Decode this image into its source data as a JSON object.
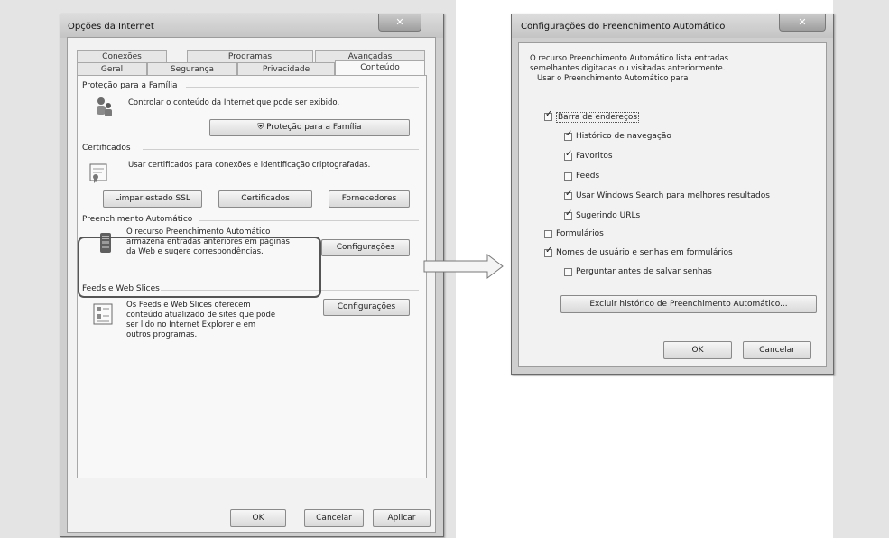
{
  "internet_options": {
    "title": "Opções da Internet",
    "close": "✕",
    "tabs_row1": [
      "Conexões",
      "Programas",
      "Avançadas"
    ],
    "tabs_row2": [
      "Geral",
      "Segurança",
      "Privacidade",
      "Conteúdo"
    ],
    "family": {
      "title": "Proteção para a Família",
      "text": "Controlar o conteúdo da Internet que pode ser exibido.",
      "button": "Proteção para a Família"
    },
    "certificates": {
      "title": "Certificados",
      "text": "Usar certificados para conexões e identificação criptografadas.",
      "buttons": [
        "Limpar estado SSL",
        "Certificados",
        "Fornecedores"
      ]
    },
    "autocomplete": {
      "title": "Preenchimento Automático",
      "text_lines": [
        "O recurso Preenchimento Automático",
        "armazena entradas anteriores em páginas",
        "da Web e sugere correspondências."
      ],
      "button": "Configurações"
    },
    "feeds": {
      "title": "Feeds e Web Slices",
      "text_lines": [
        "Os Feeds e Web Slices oferecem",
        "conteúdo atualizado de sites que pode",
        "ser lido no Internet Explorer e em",
        "outros programas."
      ],
      "button": "Configurações"
    },
    "footer": [
      "OK",
      "Cancelar",
      "Aplicar"
    ]
  },
  "autocomplete_settings": {
    "title": "Configurações do Preenchimento Automático",
    "close": "✕",
    "intro_lines": [
      "O recurso Preenchimento Automático lista entradas",
      "semelhantes digitadas ou visitadas anteriormente.",
      "Usar o Preenchimento Automático para"
    ],
    "options": {
      "address_bar": "Barra de endereços",
      "history": "Histórico de navegação",
      "favorites": "Favoritos",
      "feeds": "Feeds",
      "windows_search": "Usar Windows Search para melhores resultados",
      "suggest_urls": "Sugerindo URLs",
      "forms": "Formulários",
      "usernames": "Nomes de usuário e senhas em formulários",
      "ask_save": "Perguntar antes de salvar senhas"
    },
    "delete_history": "Excluir histórico de Preenchimento Automático...",
    "ok": "OK",
    "cancel": "Cancelar"
  },
  "checkmark": "✓"
}
